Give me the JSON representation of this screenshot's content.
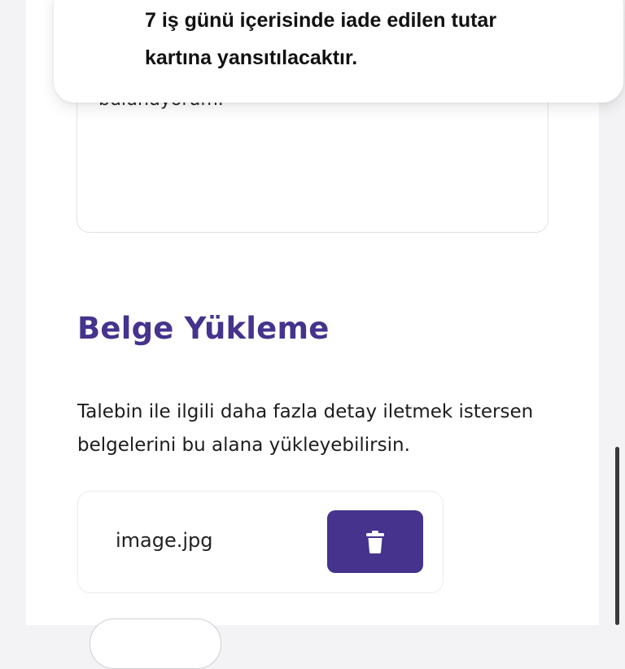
{
  "toast": {
    "message_line1": "7 iş günü içerisinde iade edilen tutar",
    "message_line2": "kartına yansıtılacaktır."
  },
  "description_field": {
    "value": "bulunuyorum."
  },
  "document_upload": {
    "title": "Belge Yükleme",
    "description": "Talebin ile ilgili daha fazla detay iletmek istersen belgelerini bu alana yükleyebilirsin.",
    "files": [
      {
        "name": "image.jpg",
        "action_icon": "trash-icon"
      }
    ]
  },
  "colors": {
    "accent": "#45338d",
    "background": "#f3f3f5"
  }
}
